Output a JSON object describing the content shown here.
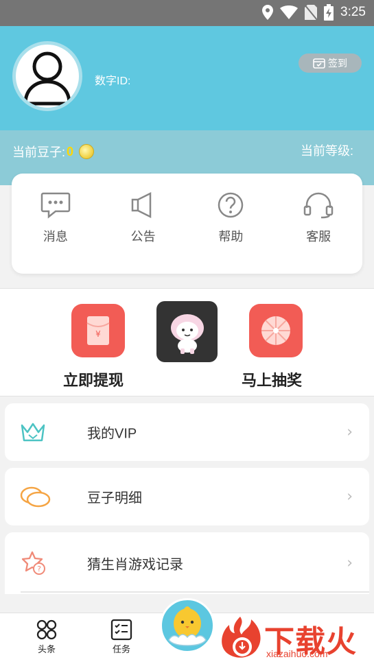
{
  "status_bar": {
    "time": "3:25"
  },
  "profile": {
    "digit_id_label": "数字ID:",
    "signin_label": "签到"
  },
  "stats": {
    "beans_label": "当前豆子:",
    "beans_value": "0",
    "level_label": "当前等级:"
  },
  "quick_links": [
    {
      "label": "消息",
      "icon": "message-icon"
    },
    {
      "label": "公告",
      "icon": "megaphone-icon"
    },
    {
      "label": "帮助",
      "icon": "help-icon"
    },
    {
      "label": "客服",
      "icon": "headset-icon"
    }
  ],
  "actions": {
    "withdraw_label": "立即提现",
    "lottery_label": "马上抽奖"
  },
  "menu": [
    {
      "label": "我的VIP",
      "icon": "crown-icon"
    },
    {
      "label": "豆子明细",
      "icon": "beans-icon"
    },
    {
      "label": "猜生肖游戏记录",
      "icon": "star-question-icon"
    }
  ],
  "tabbar": [
    {
      "label": "头条",
      "icon": "grid-icon"
    },
    {
      "label": "任务",
      "icon": "checklist-icon"
    }
  ],
  "watermark": {
    "brand": "下载火",
    "url": "xiazaihuo.com"
  },
  "colors": {
    "header": "#5fc8e0",
    "band": "#8ccbd7",
    "accent_red": "#f25c55",
    "coin_gold": "#ffd700"
  }
}
